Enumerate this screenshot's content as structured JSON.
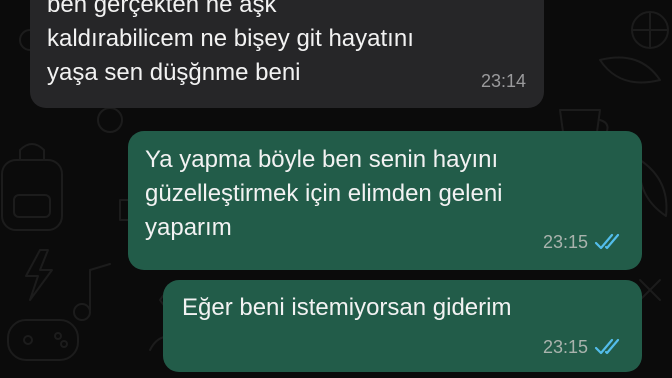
{
  "chat": {
    "messages": [
      {
        "direction": "incoming",
        "text": "ben gerçekten ne aşk\nkaldırabilicem ne bişey git hayatını\nyaşa sen düşğnme beni",
        "time": "23:14"
      },
      {
        "direction": "outgoing",
        "text": "Ya yapma böyle ben senin hayını\ngüzelleştirmek için elimden geleni\nyaparım",
        "time": "23:15",
        "status": "read"
      },
      {
        "direction": "outgoing",
        "text": "Eğer beni istemiyorsan giderim",
        "time": "23:15",
        "status": "read"
      }
    ]
  },
  "colors": {
    "background": "#0b0b0b",
    "incoming_bubble": "#262628",
    "outgoing_bubble": "#225c49",
    "read_ticks": "#53bdeb"
  },
  "icons": {
    "status": "double-check-icon"
  }
}
